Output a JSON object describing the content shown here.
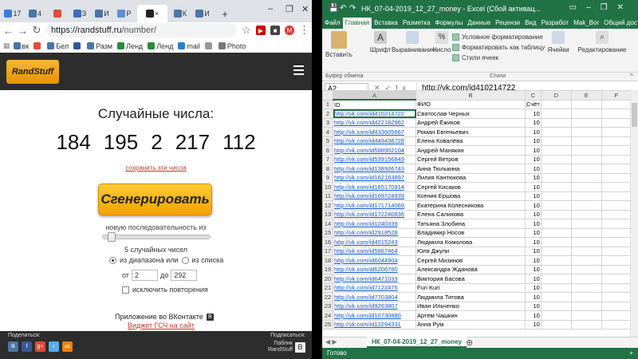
{
  "browser": {
    "tabs": [
      {
        "label": "17",
        "color": "#3b7cd8"
      },
      {
        "label": "4",
        "color": "#4a76a8"
      },
      {
        "label": "",
        "color": "#e34b3b"
      },
      {
        "label": "З",
        "color": "#3a6fc2"
      },
      {
        "label": "И",
        "color": "#4a76a8"
      },
      {
        "label": "Р",
        "color": "#5d8fd0"
      },
      {
        "label": "",
        "color": "#222"
      },
      {
        "label": "К",
        "color": "#4a76a8"
      },
      {
        "label": "И",
        "color": "#4a76a8"
      }
    ],
    "active_tab_index": 6,
    "url_host": "https://randstuff.ru",
    "url_path": "/number/",
    "bookmarks": [
      {
        "label": "вк",
        "color": "#4a76a8"
      },
      {
        "label": "",
        "color": "#e34b3b"
      },
      {
        "label": "Бел",
        "color": "#4a76a8"
      },
      {
        "label": "",
        "color": "#2b5797"
      },
      {
        "label": "Разм",
        "color": "#4a76a8"
      },
      {
        "label": "Ленд",
        "color": "#2a8a3a"
      },
      {
        "label": "Ленд",
        "color": "#2a8a3a"
      },
      {
        "label": "mail",
        "color": "#2d7dd2"
      },
      {
        "label": "",
        "color": "#999"
      },
      {
        "label": "Photo",
        "color": "#777"
      }
    ]
  },
  "site": {
    "logo": "RandStuff",
    "title": "Случайные числа:",
    "numbers": [
      "184",
      "195",
      "2",
      "217",
      "112"
    ],
    "save_link": "сохранить эти числа",
    "generate_button": "Сгенерировать",
    "sequence_label": "новую последовательность из",
    "slider_fraction": 0.05,
    "count_label": "5 случайных чисел",
    "from_range_label": "из диапазона или",
    "from_list_label": "из списка",
    "from_label": "от",
    "from_value": "2",
    "to_label": "до",
    "to_value": "292",
    "no_repeat_label": "исключить повторения",
    "vk_app_label": "Приложение во ВКонтакте",
    "vk_badge": "B",
    "widget_link": "Виджет ГСЧ на сайт",
    "share_label": "Поделиться:",
    "share_icons": [
      {
        "name": "vk",
        "glyph": "B",
        "color": "#4a76a8"
      },
      {
        "name": "facebook",
        "glyph": "f",
        "color": "#3b5998"
      },
      {
        "name": "google-plus",
        "glyph": "g+",
        "color": "#dd4b39"
      },
      {
        "name": "twitter",
        "glyph": "t",
        "color": "#55acee"
      },
      {
        "name": "odnoklassniki",
        "glyph": "ок",
        "color": "#ee8208"
      }
    ],
    "subscribe_label": "Подписаться:",
    "vk_public_line1": "Паблик",
    "vk_public_line2": "RandStuff"
  },
  "excel": {
    "title": "НК_07-04-2019_12_27_money - Excel (Сбой активац...",
    "tabs": [
      "Файл",
      "Главная",
      "Вставка",
      "Разметка",
      "Формулы",
      "Данные",
      "Рецензи",
      "Вид",
      "Разработ",
      "Mak_Bor",
      "Общий доступ"
    ],
    "active_tab": 1,
    "ribbon": {
      "paste": "Вставить",
      "font": "Шрифт",
      "align": "Выравнивание",
      "number": "Число",
      "cond_format": "Условное форматирование",
      "format_table": "Форматировать как таблицу",
      "cell_styles": "Стили ячеек",
      "cells": "Ячейки",
      "editing": "Редактирование",
      "clipboard_group": "Буфер обмена",
      "styles_group": "Стили"
    },
    "name_box": "A2",
    "formula": "http://vk.com/id410214722",
    "columns": [
      "A",
      "B",
      "C",
      "D",
      "E",
      "F"
    ],
    "rows": [
      [
        "ID",
        "ФИО",
        "Счёт"
      ],
      [
        "http://vk.com/id410214722",
        "Святослав Черных",
        "10"
      ],
      [
        "http://vk.com/id422182962",
        "Андрей Ёжиков",
        "10"
      ],
      [
        "http://vk.com/id433605667",
        "Роман Евгеньевич",
        "10"
      ],
      [
        "http://vk.com/id449438728",
        "Елена Ковалёва",
        "10"
      ],
      [
        "http://vk.com/id508902104",
        "Андрей Манякин",
        "10"
      ],
      [
        "http://vk.com/id539156849",
        "Сергей Ветров",
        "10"
      ],
      [
        "http://vk.com/id138926743",
        "Анна Тюлькина",
        "10"
      ],
      [
        "http://vk.com/id162163897",
        "Лилия Кантюкова",
        "10"
      ],
      [
        "http://vk.com/id165170914",
        "Сергей Кисаков",
        "10"
      ],
      [
        "http://vk.com/id169724939",
        "Ксения Ершова",
        "10"
      ],
      [
        "http://vk.com/id171714069",
        "Екатерина Колесникова",
        "10"
      ],
      [
        "http://vk.com/id172240836",
        "Елена Салихова",
        "10"
      ],
      [
        "http://vk.com/id1240339",
        "Татьяна Злобина",
        "10"
      ],
      [
        "http://vk.com/id2918528",
        "Владимир Носов",
        "10"
      ],
      [
        "http://vk.com/id4015243",
        "Людмила Комолова",
        "10"
      ],
      [
        "http://vk.com/id5867464",
        "Юля Джули",
        "10"
      ],
      [
        "http://vk.com/id6044904",
        "Сергей Мизинов",
        "10"
      ],
      [
        "http://vk.com/id6206780",
        "Александра Жданова",
        "10"
      ],
      [
        "http://vk.com/id6471033",
        "Виктория Басова",
        "10"
      ],
      [
        "http://vk.com/id7122475",
        "Furi Kuri",
        "10"
      ],
      [
        "http://vk.com/id7703804",
        "Людмила Титова",
        "10"
      ],
      [
        "http://vk.com/id9263807",
        "Иван Ильченко",
        "10"
      ],
      [
        "http://vk.com/id10730880",
        "Артём Чашкин",
        "10"
      ],
      [
        "http://vk.com/id12294331",
        "Анна Рум",
        "10"
      ]
    ],
    "sheet_tab": "НК_07-04-2019_12_27_money",
    "status": "Готово",
    "zoom_label": "+"
  }
}
